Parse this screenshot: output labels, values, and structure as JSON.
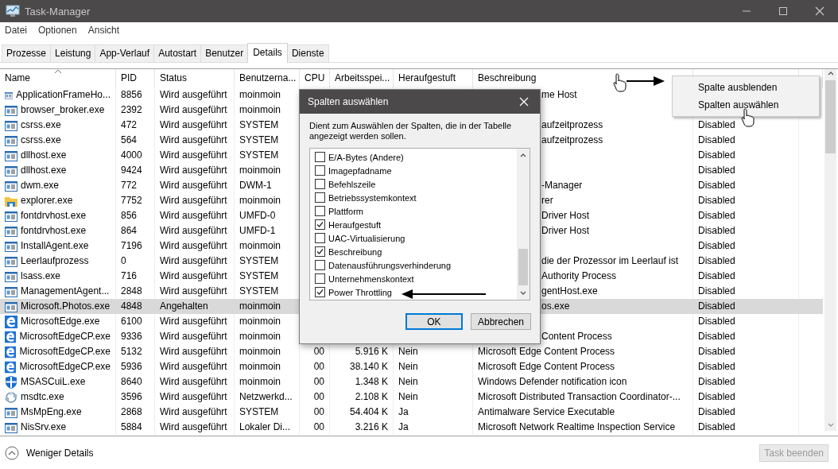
{
  "window": {
    "title": "Task-Manager"
  },
  "menu": [
    "Datei",
    "Optionen",
    "Ansicht"
  ],
  "tabs": [
    {
      "label": "Prozesse",
      "selected": false
    },
    {
      "label": "Leistung",
      "selected": false
    },
    {
      "label": "App-Verlauf",
      "selected": false
    },
    {
      "label": "Autostart",
      "selected": false
    },
    {
      "label": "Benutzer",
      "selected": false
    },
    {
      "label": "Details",
      "selected": true
    },
    {
      "label": "Dienste",
      "selected": false
    }
  ],
  "table": {
    "columns": [
      {
        "label": "Name",
        "sorted": true
      },
      {
        "label": "PID",
        "sorted": false
      },
      {
        "label": "Status",
        "sorted": false
      },
      {
        "label": "Benutzerna...",
        "sorted": false
      },
      {
        "label": "CPU",
        "sorted": false
      },
      {
        "label": "Arbeitsspei...",
        "sorted": false
      },
      {
        "label": "Heraufgestuft",
        "sorted": false
      },
      {
        "label": "Beschreibung",
        "sorted": false
      }
    ],
    "rows": [
      {
        "kind": "window",
        "name": "ApplicationFrameHo...",
        "pid": "8856",
        "status": "Wird ausgeführt",
        "user": "moinmoin",
        "description": "me Host",
        "selected": false
      },
      {
        "kind": "window",
        "name": "browser_broker.exe",
        "pid": "2392",
        "status": "Wird ausgeführt",
        "user": "moinmoin",
        "selected": false
      },
      {
        "kind": "window",
        "name": "csrss.exe",
        "pid": "472",
        "status": "Wird ausgeführt",
        "user": "SYSTEM",
        "description": "aufzeitprozess",
        "power_throttling": "Disabled",
        "selected": false
      },
      {
        "kind": "window",
        "name": "csrss.exe",
        "pid": "564",
        "status": "Wird ausgeführt",
        "user": "SYSTEM",
        "description": "aufzeitprozess",
        "power_throttling": "Disabled",
        "selected": false
      },
      {
        "kind": "window",
        "name": "dllhost.exe",
        "pid": "4000",
        "status": "Wird ausgeführt",
        "user": "SYSTEM",
        "power_throttling": "Disabled",
        "selected": false
      },
      {
        "kind": "window",
        "name": "dllhost.exe",
        "pid": "9424",
        "status": "Wird ausgeführt",
        "user": "moinmoin",
        "power_throttling": "Disabled",
        "selected": false
      },
      {
        "kind": "window",
        "name": "dwm.exe",
        "pid": "772",
        "status": "Wird ausgeführt",
        "user": "DWM-1",
        "description": "-Manager",
        "power_throttling": "Disabled",
        "selected": false
      },
      {
        "kind": "folder",
        "name": "explorer.exe",
        "pid": "7752",
        "status": "Wird ausgeführt",
        "user": "moinmoin",
        "description": "rer",
        "power_throttling": "Disabled",
        "selected": false
      },
      {
        "kind": "window",
        "name": "fontdrvhost.exe",
        "pid": "856",
        "status": "Wird ausgeführt",
        "user": "UMFD-0",
        "description": "Driver Host",
        "power_throttling": "Disabled",
        "selected": false
      },
      {
        "kind": "window",
        "name": "fontdrvhost.exe",
        "pid": "864",
        "status": "Wird ausgeführt",
        "user": "UMFD-1",
        "description": "Driver Host",
        "power_throttling": "Disabled",
        "selected": false
      },
      {
        "kind": "window",
        "name": "InstallAgent.exe",
        "pid": "7196",
        "status": "Wird ausgeführt",
        "user": "moinmoin",
        "power_throttling": "Disabled",
        "selected": false
      },
      {
        "kind": "window",
        "name": "Leerlaufprozess",
        "pid": "0",
        "status": "Wird ausgeführt",
        "user": "SYSTEM",
        "description": "die der Prozessor im Leerlauf ist",
        "power_throttling": "Disabled",
        "selected": false
      },
      {
        "kind": "window",
        "name": "lsass.exe",
        "pid": "716",
        "status": "Wird ausgeführt",
        "user": "SYSTEM",
        "description": "Authority Process",
        "power_throttling": "Disabled",
        "selected": false
      },
      {
        "kind": "window",
        "name": "ManagementAgent...",
        "pid": "2848",
        "status": "Wird ausgeführt",
        "user": "SYSTEM",
        "description": "gentHost.exe",
        "power_throttling": "Disabled",
        "selected": false
      },
      {
        "kind": "window",
        "name": "Microsoft.Photos.exe",
        "pid": "4848",
        "status": "Angehalten",
        "user": "moinmoin",
        "description": "os.exe",
        "power_throttling": "Disabled",
        "selected": true
      },
      {
        "kind": "edge",
        "name": "MicrosoftEdge.exe",
        "pid": "6100",
        "status": "Wird ausgeführt",
        "user": "moinmoin",
        "power_throttling": "Disabled",
        "selected": false
      },
      {
        "kind": "edge",
        "name": "MicrosoftEdgeCP.exe",
        "pid": "9336",
        "status": "Wird ausgeführt",
        "user": "moinmoin",
        "description": "Content Process",
        "power_throttling": "Disabled",
        "selected": false
      },
      {
        "kind": "edge",
        "name": "MicrosoftEdgeCP.exe",
        "pid": "5132",
        "status": "Wird ausgeführt",
        "user": "moinmoin",
        "cpu": "00",
        "memory": "5.916 K",
        "elevated": "Nein",
        "description": "Microsoft Edge Content Process",
        "power_throttling": "Disabled",
        "selected": false
      },
      {
        "kind": "edge",
        "name": "MicrosoftEdgeCP.exe",
        "pid": "5936",
        "status": "Wird ausgeführt",
        "user": "moinmoin",
        "cpu": "00",
        "memory": "38.140 K",
        "elevated": "Nein",
        "description": "Microsoft Edge Content Process",
        "power_throttling": "Disabled",
        "selected": false
      },
      {
        "kind": "shield",
        "name": "MSASCuiL.exe",
        "pid": "8640",
        "status": "Wird ausgeführt",
        "user": "moinmoin",
        "cpu": "00",
        "memory": "1.348 K",
        "elevated": "Nein",
        "description": "Windows Defender notification icon",
        "power_throttling": "Disabled",
        "selected": false
      },
      {
        "kind": "network",
        "name": "msdtc.exe",
        "pid": "3596",
        "status": "Wird ausgeführt",
        "user": "Netzwerkd...",
        "cpu": "00",
        "memory": "2.108 K",
        "elevated": "Nein",
        "description": "Microsoft Distributed Transaction Coordinator-...",
        "power_throttling": "Disabled",
        "selected": false
      },
      {
        "kind": "window",
        "name": "MsMpEng.exe",
        "pid": "2868",
        "status": "Wird ausgeführt",
        "user": "SYSTEM",
        "cpu": "00",
        "memory": "54.404 K",
        "elevated": "Ja",
        "description": "Antimalware Service Executable",
        "power_throttling": "Disabled",
        "selected": false
      },
      {
        "kind": "window",
        "name": "NisSrv.exe",
        "pid": "5884",
        "status": "Wird ausgeführt",
        "user": "Lokaler Di...",
        "cpu": "00",
        "memory": "3.216 K",
        "elevated": "Ja",
        "description": "Microsoft Network Realtime Inspection Service",
        "power_throttling": "Disabled",
        "selected": false
      }
    ]
  },
  "context_menu": {
    "items": [
      "Spalte ausblenden",
      "Spalten auswählen"
    ]
  },
  "dialog": {
    "title": "Spalten auswählen",
    "description": "Dient zum Auswählen der Spalten, die in der Tabelle angezeigt werden sollen.",
    "options": [
      {
        "label": "E/A-Bytes (Andere)",
        "checked": false
      },
      {
        "label": "Imagepfadname",
        "checked": false
      },
      {
        "label": "Befehlszeile",
        "checked": false
      },
      {
        "label": "Betriebssystemkontext",
        "checked": false
      },
      {
        "label": "Plattform",
        "checked": false
      },
      {
        "label": "Heraufgestuft",
        "checked": true
      },
      {
        "label": "UAC-Virtualisierung",
        "checked": false
      },
      {
        "label": "Beschreibung",
        "checked": true
      },
      {
        "label": "Datenausführungsverhinderung",
        "checked": false
      },
      {
        "label": "Unternehmenskontext",
        "checked": false
      },
      {
        "label": "Power Throttling",
        "checked": true
      }
    ],
    "buttons": [
      {
        "label": "OK",
        "default": true
      },
      {
        "label": "Abbrechen",
        "default": false
      }
    ]
  },
  "footer": {
    "toggle_label": "Weniger Details",
    "end_task": {
      "label": "Task beenden",
      "disabled": true
    }
  }
}
